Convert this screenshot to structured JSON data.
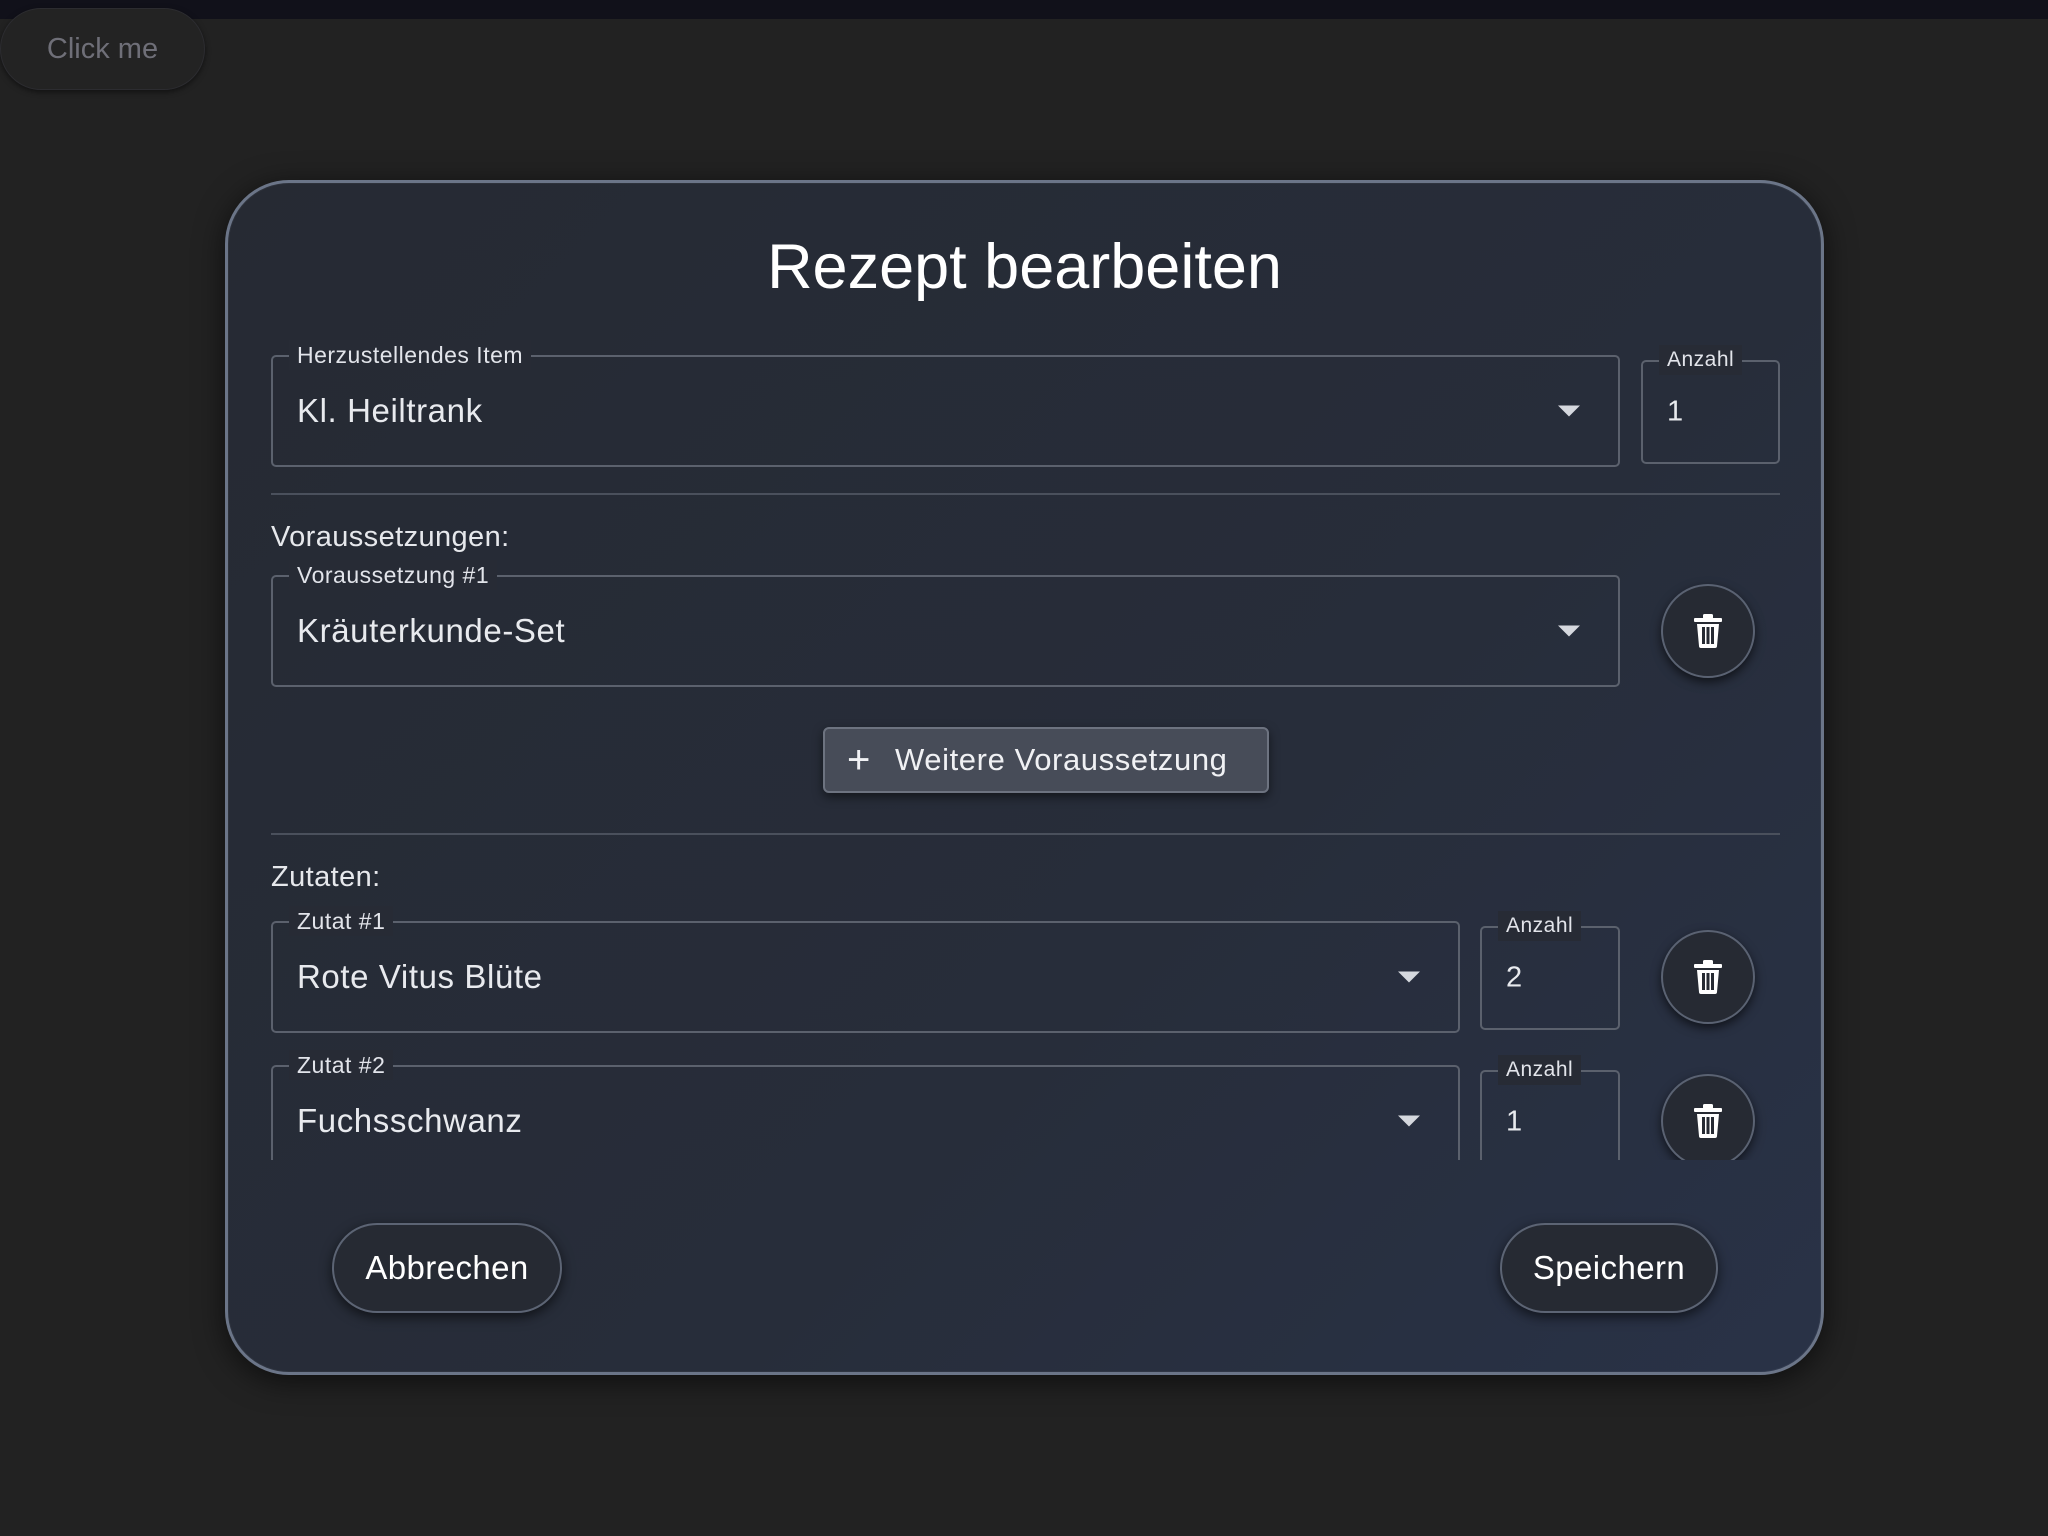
{
  "page": {
    "click_me_label": "Click me"
  },
  "dialog": {
    "title": "Rezept bearbeiten",
    "item": {
      "legend": "Herzustellendes Item",
      "value": "Kl. Heiltrank",
      "quantity_legend": "Anzahl",
      "quantity": "1"
    },
    "prerequisites": {
      "section_label": "Voraussetzungen:",
      "items": [
        {
          "legend": "Voraussetzung #1",
          "value": "Kräuterkunde-Set"
        }
      ],
      "add_label": "Weitere Voraussetzung"
    },
    "ingredients": {
      "section_label": "Zutaten:",
      "items": [
        {
          "legend": "Zutat #1",
          "value": "Rote Vitus Blüte",
          "quantity_legend": "Anzahl",
          "quantity": "2"
        },
        {
          "legend": "Zutat #2",
          "value": "Fuchsschwanz",
          "quantity_legend": "Anzahl",
          "quantity": "1"
        }
      ]
    },
    "cancel_label": "Abbrechen",
    "save_label": "Speichern"
  }
}
